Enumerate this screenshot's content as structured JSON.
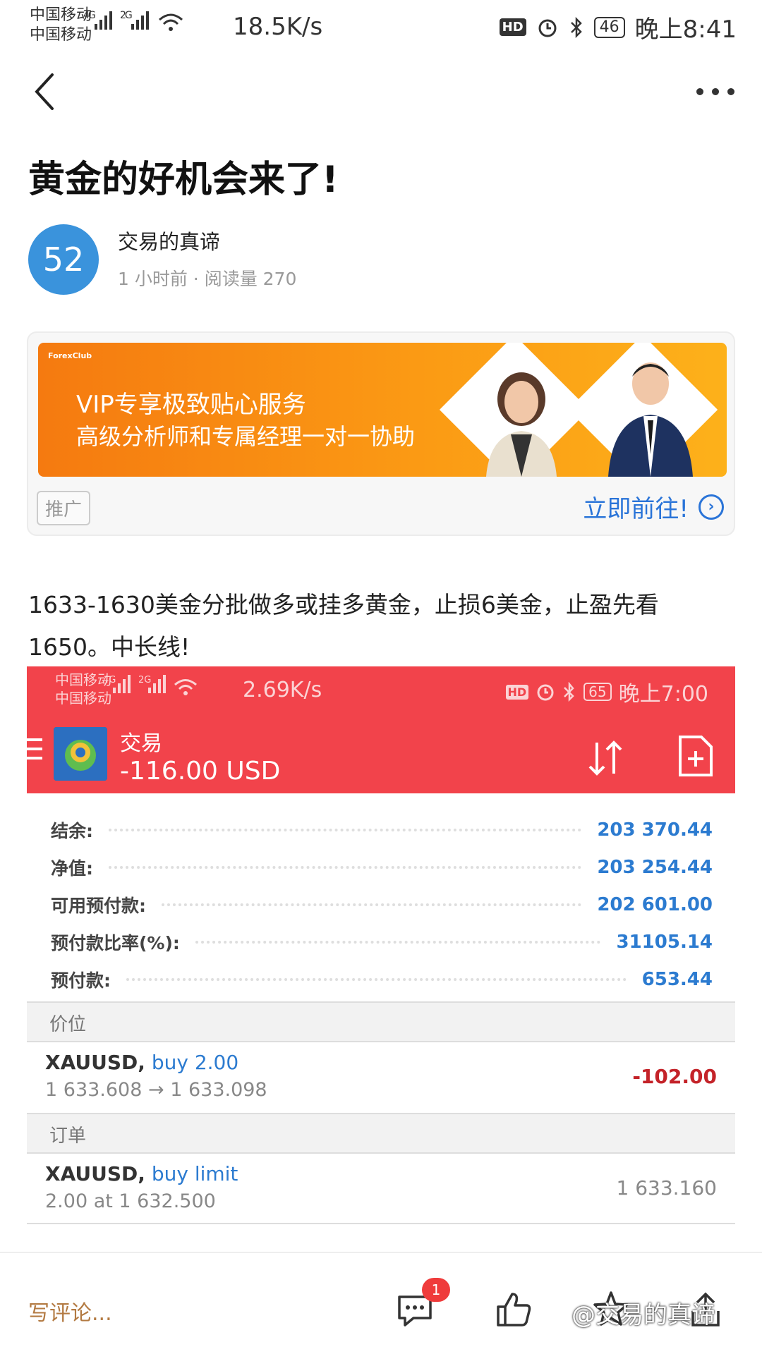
{
  "status_bar": {
    "carrier_1": "中国移动",
    "carrier_2": "中国移动",
    "net_1": "4G",
    "net_2": "2G",
    "speed": "18.5K/s",
    "hd": "HD",
    "battery": "46",
    "time": "晚上8:41"
  },
  "article": {
    "title": "黄金的好机会来了!",
    "author_avatar_text": "52",
    "author_name": "交易的真谛",
    "meta": "1 小时前 · 阅读量 270",
    "body": "1633-1630美金分批做多或挂多黄金，止损6美金，止盈先看1650。中长线!"
  },
  "ad": {
    "logo": "ForexClub",
    "line1": "VIP专享极致贴心服务",
    "line2": "高级分析师和专属经理一对一协助",
    "tag": "推广",
    "cta": "立即前往!"
  },
  "embedded_screenshot": {
    "status_bar": {
      "carrier_1": "中国移动",
      "carrier_2": "中国移动",
      "net_1": "4G",
      "net_2": "2G",
      "speed": "2.69K/s",
      "hd": "HD",
      "battery": "65",
      "time": "晚上7:00"
    },
    "header": {
      "title": "交易",
      "pnl": "-116.00 USD"
    },
    "account": [
      {
        "label": "结余:",
        "value": "203 370.44"
      },
      {
        "label": "净值:",
        "value": "203 254.44"
      },
      {
        "label": "可用预付款:",
        "value": "202 601.00"
      },
      {
        "label": "预付款比率(%):",
        "value": "31105.14"
      },
      {
        "label": "预付款:",
        "value": "653.44"
      }
    ],
    "positions_header": "价位",
    "position": {
      "symbol": "XAUUSD,",
      "direction": "buy 2.00",
      "prices": "1 633.608 → 1 633.098",
      "profit": "-102.00"
    },
    "orders_header": "订单",
    "order": {
      "symbol": "XAUUSD,",
      "direction": "buy limit",
      "detail": "2.00 at 1 632.500",
      "price": "1 633.160"
    }
  },
  "bottom_bar": {
    "comment_placeholder": "写评论...",
    "comment_badge": "1",
    "watermark": "@交易的真谛"
  },
  "colors": {
    "brand_blue": "#2c7bd0",
    "mt_header_red": "#f2434b",
    "loss_red": "#c42329",
    "ad_orange": "#f57a10"
  }
}
